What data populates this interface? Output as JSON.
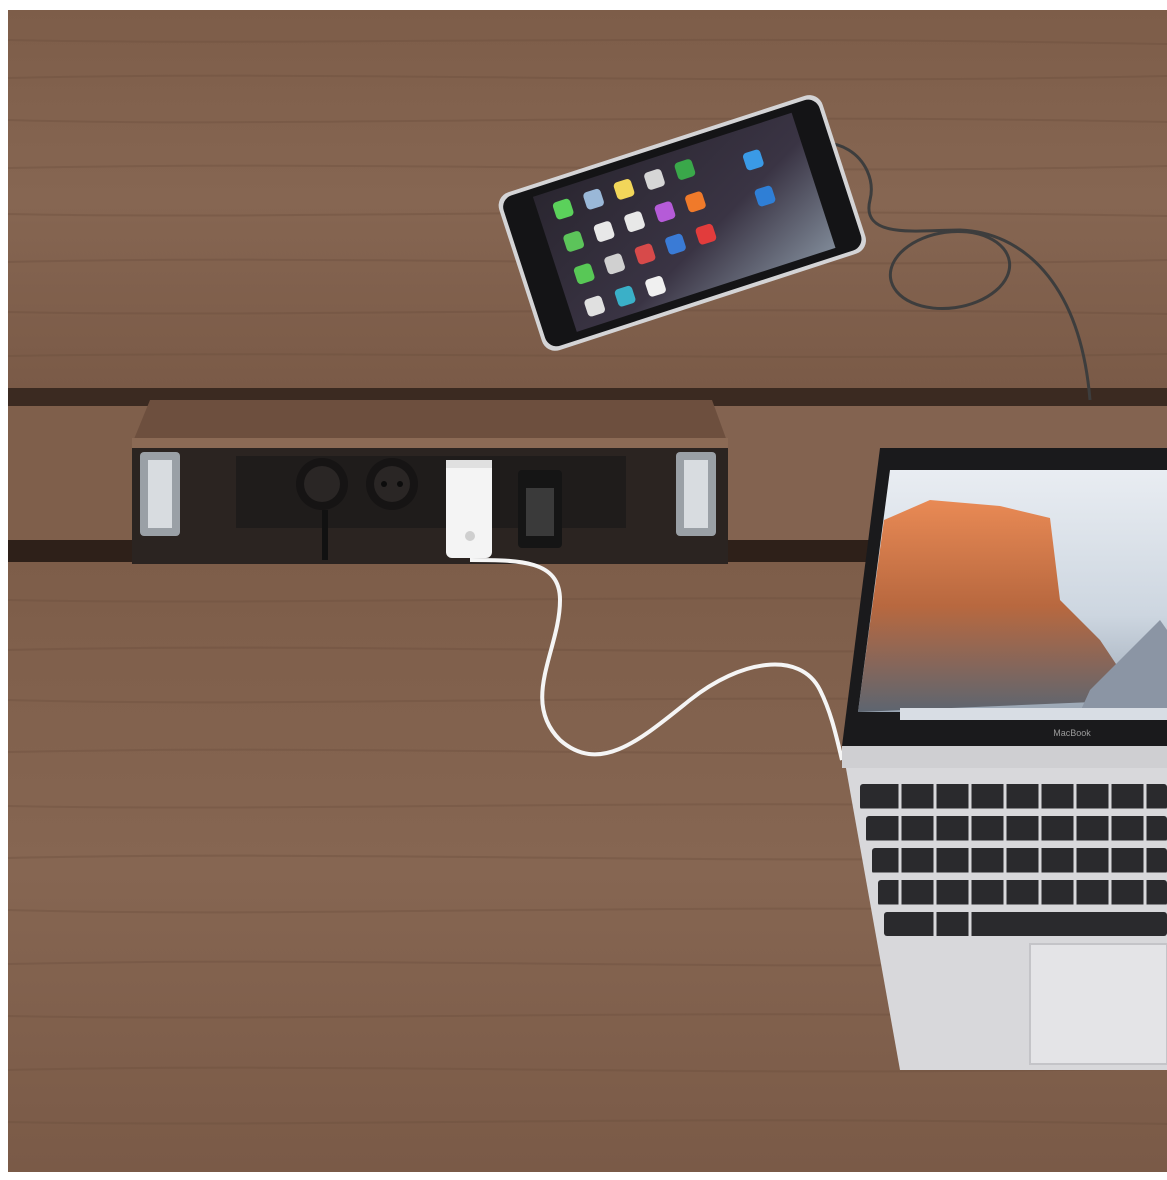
{
  "scene": {
    "description_free": true,
    "colors": {
      "frame": "#ffffff",
      "wood_light": "#8a6a55",
      "wood_mid": "#7a5a46",
      "wood_dark": "#5e4233",
      "slot_shadow": "#2a1c15",
      "tray_inside": "#3a3431",
      "tablet_body": "#1c1c1e",
      "tablet_bezel": "#c9c9cc",
      "cable_white": "#f2f2f2",
      "cable_dark": "#3a3a3a",
      "laptop_silver": "#d9d9dc",
      "laptop_screen_bezel": "#121214",
      "keyboard_key": "#2b2b2e",
      "sky": "#dfe6ee",
      "cliff": "#d9733f"
    },
    "laptop_brand_text": "MacBook"
  }
}
